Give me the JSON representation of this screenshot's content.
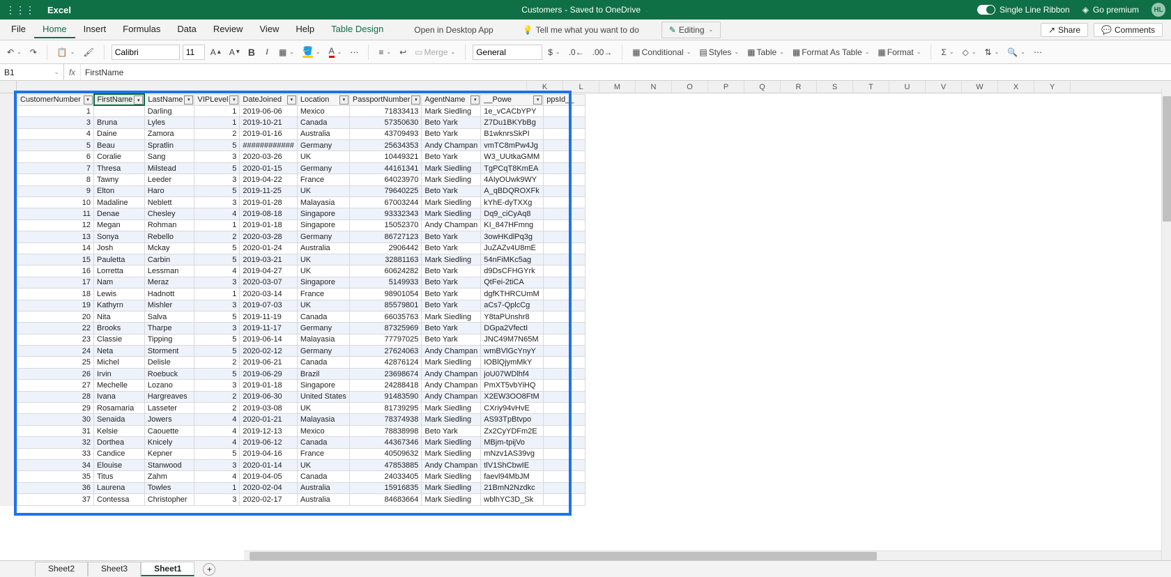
{
  "app": {
    "name": "Excel",
    "doc_title": "Customers",
    "doc_suffix": " - Saved to OneDrive"
  },
  "title_right": {
    "single_line": "Single Line Ribbon",
    "premium": "Go premium",
    "initials": "HL"
  },
  "menu_tabs": [
    "File",
    "Home",
    "Insert",
    "Formulas",
    "Data",
    "Review",
    "View",
    "Help",
    "Table Design"
  ],
  "menu_extras": {
    "desktop": "Open in Desktop App",
    "tellme": "Tell me what you want to do",
    "editing": "Editing",
    "share": "Share",
    "comments": "Comments"
  },
  "ribbon": {
    "font_name": "Calibri",
    "font_size": "11",
    "num_fmt": "General",
    "merge": "Merge",
    "conditional": "Conditional",
    "styles": "Styles",
    "table": "Table",
    "fmt_as_table": "Format As Table",
    "format": "Format"
  },
  "name_box": "B1",
  "formula_value": "FirstName",
  "columns": {
    "data_widths": [
      110,
      72,
      70,
      62,
      78,
      70,
      100,
      80,
      90
    ],
    "letters": [
      "K",
      "L",
      "M",
      "N",
      "O",
      "P",
      "Q",
      "R",
      "S",
      "T",
      "U",
      "V",
      "W",
      "X",
      "Y"
    ]
  },
  "headers": [
    "CustomerNumber",
    "FirstName",
    "LastName",
    "VIPLevel",
    "DateJoined",
    "Location",
    "PassportNumber",
    "AgentName",
    "__Powe"
  ],
  "header_end": "ppsId__",
  "chart_data": {
    "type": "table",
    "columns": [
      "CustomerNumber",
      "FirstName",
      "LastName",
      "VIPLevel",
      "DateJoined",
      "Location",
      "PassportNumber",
      "AgentName",
      "__PowerAppsId__"
    ],
    "rows": [
      [
        1,
        "",
        "Darling",
        1,
        "2019-06-06",
        "Mexico",
        71833413,
        "Mark Siedling",
        "1e_vCACbYPY"
      ],
      [
        3,
        "Bruna",
        "Lyles",
        1,
        "2019-10-21",
        "Canada",
        57350630,
        "Beto Yark",
        "Z7Du1BKYbBg"
      ],
      [
        4,
        "Daine",
        "Zamora",
        2,
        "2019-01-16",
        "Australia",
        43709493,
        "Beto Yark",
        "B1wknrsSkPI"
      ],
      [
        5,
        "Beau",
        "Spratlin",
        5,
        "############",
        "Germany",
        25634353,
        "Andy Champan",
        "vmTC8mPw4Jg"
      ],
      [
        6,
        "Coralie",
        "Sang",
        3,
        "2020-03-26",
        "UK",
        10449321,
        "Beto Yark",
        "W3_UUtkaGMM"
      ],
      [
        7,
        "Thresa",
        "Milstead",
        5,
        "2020-01-15",
        "Germany",
        44161341,
        "Mark Siedling",
        "TgPCqT8KmEA"
      ],
      [
        8,
        "Tawny",
        "Leeder",
        3,
        "2019-04-22",
        "France",
        64023970,
        "Mark Siedling",
        "4AIyOUwk9WY"
      ],
      [
        9,
        "Elton",
        "Haro",
        5,
        "2019-11-25",
        "UK",
        79640225,
        "Beto Yark",
        "A_qBDQROXFk"
      ],
      [
        10,
        "Madaline",
        "Neblett",
        3,
        "2019-01-28",
        "Malayasia",
        67003244,
        "Mark Siedling",
        "kYhE-dyTXXg"
      ],
      [
        11,
        "Denae",
        "Chesley",
        4,
        "2019-08-18",
        "Singapore",
        93332343,
        "Mark Siedling",
        "Dq9_ciCyAq8"
      ],
      [
        12,
        "Megan",
        "Rohman",
        1,
        "2019-01-18",
        "Singapore",
        15052370,
        "Andy Champan",
        "KI_847HFmng"
      ],
      [
        13,
        "Sonya",
        "Rebello",
        2,
        "2020-03-28",
        "Germany",
        86727123,
        "Beto Yark",
        "3owHKdlPq3g"
      ],
      [
        14,
        "Josh",
        "Mckay",
        5,
        "2020-01-24",
        "Australia",
        2906442,
        "Beto Yark",
        "JuZAZv4U8mE"
      ],
      [
        15,
        "Pauletta",
        "Carbin",
        5,
        "2019-03-21",
        "UK",
        32881163,
        "Mark Siedling",
        "54nFiMKc5ag"
      ],
      [
        16,
        "Lorretta",
        "Lessman",
        4,
        "2019-04-27",
        "UK",
        60624282,
        "Beto Yark",
        "d9DsCFHGYrk"
      ],
      [
        17,
        "Nam",
        "Meraz",
        3,
        "2020-03-07",
        "Singapore",
        5149933,
        "Beto Yark",
        "QtFei-2tiCA"
      ],
      [
        18,
        "Lewis",
        "Hadnott",
        1,
        "2020-03-14",
        "France",
        98901054,
        "Beto Yark",
        "dgfKTHRCUmM"
      ],
      [
        19,
        "Kathyrn",
        "Mishler",
        3,
        "2019-07-03",
        "UK",
        85579801,
        "Beto Yark",
        "aCs7-QplcCg"
      ],
      [
        20,
        "Nita",
        "Salva",
        5,
        "2019-11-19",
        "Canada",
        66035763,
        "Mark Siedling",
        "Y8taPUnshr8"
      ],
      [
        22,
        "Brooks",
        "Tharpe",
        3,
        "2019-11-17",
        "Germany",
        87325969,
        "Beto Yark",
        "DGpa2VfectI"
      ],
      [
        23,
        "Classie",
        "Tipping",
        5,
        "2019-06-14",
        "Malayasia",
        77797025,
        "Beto Yark",
        "JNC49M7N65M"
      ],
      [
        24,
        "Neta",
        "Storment",
        5,
        "2020-02-12",
        "Germany",
        27624063,
        "Andy Champan",
        "wmBVlGcYnyY"
      ],
      [
        25,
        "Michel",
        "Delisle",
        2,
        "2019-06-21",
        "Canada",
        42876124,
        "Mark Siedling",
        "IOBlQjymMkY"
      ],
      [
        26,
        "Irvin",
        "Roebuck",
        5,
        "2019-06-29",
        "Brazil",
        23698674,
        "Andy Champan",
        "joU07WDlhf4"
      ],
      [
        27,
        "Mechelle",
        "Lozano",
        3,
        "2019-01-18",
        "Singapore",
        24288418,
        "Andy Champan",
        "PmXT5vbYiHQ"
      ],
      [
        28,
        "Ivana",
        "Hargreaves",
        2,
        "2019-06-30",
        "United States",
        91483590,
        "Andy Champan",
        "X2EW3OO8FtM"
      ],
      [
        29,
        "Rosamaria",
        "Lasseter",
        2,
        "2019-03-08",
        "UK",
        81739295,
        "Mark Siedling",
        "CXriy94vHvE"
      ],
      [
        30,
        "Senaida",
        "Jowers",
        4,
        "2020-01-21",
        "Malayasia",
        78374938,
        "Mark Siedling",
        "AS93TpBtvpo"
      ],
      [
        31,
        "Kelsie",
        "Caouette",
        4,
        "2019-12-13",
        "Mexico",
        78838998,
        "Beto Yark",
        "Zx2CyYDFm2E"
      ],
      [
        32,
        "Dorthea",
        "Knicely",
        4,
        "2019-06-12",
        "Canada",
        44367346,
        "Mark Siedling",
        "MBjm-tpijVo"
      ],
      [
        33,
        "Candice",
        "Kepner",
        5,
        "2019-04-16",
        "France",
        40509632,
        "Mark Siedling",
        "mNzv1AS39vg"
      ],
      [
        34,
        "Elouise",
        "Stanwood",
        3,
        "2020-01-14",
        "UK",
        47853885,
        "Andy Champan",
        "tlV1ShCbwIE"
      ],
      [
        35,
        "Titus",
        "Zahm",
        4,
        "2019-04-05",
        "Canada",
        24033405,
        "Mark Siedling",
        "faevl94MbJM"
      ],
      [
        36,
        "Laurena",
        "Towles",
        1,
        "2020-02-04",
        "Australia",
        15916835,
        "Mark Siedling",
        "21BmN2Nzdkc"
      ],
      [
        37,
        "Contessa",
        "Christopher",
        3,
        "2020-02-17",
        "Australia",
        84683664,
        "Mark Siedling",
        "wblhYC3D_Sk"
      ]
    ]
  },
  "sheets": [
    "Sheet2",
    "Sheet3",
    "Sheet1"
  ],
  "active_sheet": 2,
  "active_menu": 1
}
